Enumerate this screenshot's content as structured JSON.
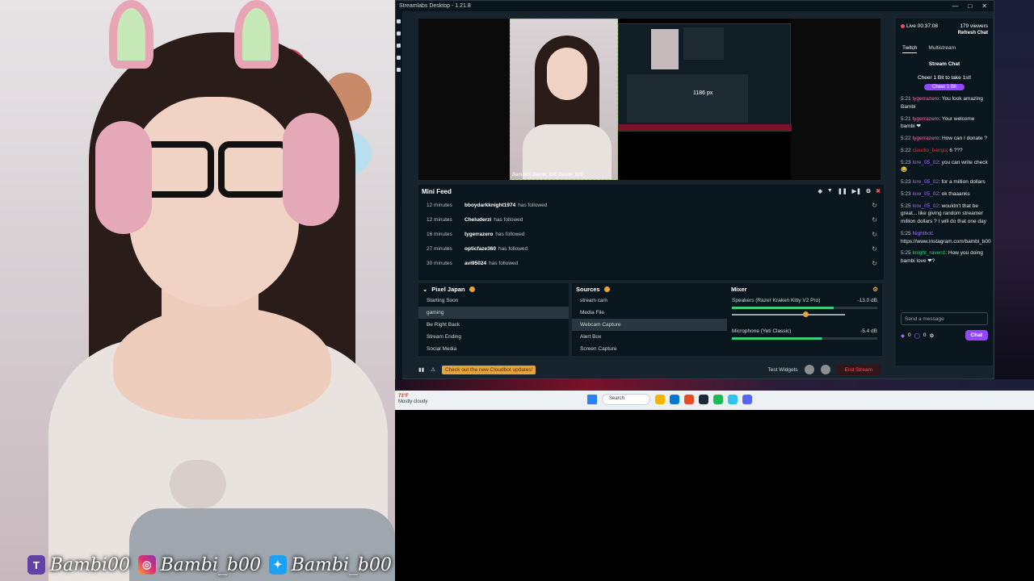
{
  "overlay": {
    "handles": [
      {
        "platform_icon": "twitch-icon",
        "name": "Bambi00"
      },
      {
        "platform_icon": "instagram-icon",
        "name": "Bambi_b00"
      },
      {
        "platform_icon": "twitter-icon",
        "name": "Bambi_b00"
      }
    ]
  },
  "app": {
    "title": "Streamlabs Desktop - 1.21.8",
    "preview_dimension": "1186 px",
    "preview_tag": "Bambi00 Bambi_b00 Bambi_b00"
  },
  "mini_feed": {
    "title": "Mini Feed",
    "events": [
      {
        "ago": "12 minutes",
        "user": "bboydarkknight1974",
        "action": "has followed"
      },
      {
        "ago": "12 minutes",
        "user": "Cheluderzi",
        "action": "has followed"
      },
      {
        "ago": "16 minutes",
        "user": "tygerrazero",
        "action": "has followed"
      },
      {
        "ago": "27 minutes",
        "user": "opticfaze360",
        "action": "has followed"
      },
      {
        "ago": "30 minutes",
        "user": "avi95024",
        "action": "has followed"
      }
    ]
  },
  "scenes": {
    "title": "Pixel Japan",
    "items": [
      "Starting Soon",
      "gaming",
      "Be Right Back",
      "Stream Ending",
      "Social Media"
    ],
    "selected": "gaming"
  },
  "sources": {
    "title": "Sources",
    "items": [
      "stream cam",
      "Media File",
      "Webcam Capture",
      "Alert Box",
      "Screen Capture"
    ],
    "selected": "Webcam Capture"
  },
  "mixer": {
    "title": "Mixer",
    "channels": [
      {
        "name": "Speakers (Razer Kraken Kitty V2 Pro)",
        "db": "-13.0 dB",
        "level": 0.7
      },
      {
        "name": "Microphone (Yeti Classic)",
        "db": "-5.4 dB",
        "level": 0.62
      }
    ]
  },
  "footer": {
    "notice": "Check out the new Cloudbot updates!",
    "test_widgets": "Test Widgets",
    "end_stream": "End Stream"
  },
  "chat": {
    "live_time": "Live 00:37:08",
    "viewers": "179 viewers",
    "refresh": "Refresh Chat",
    "tabs": [
      "Twitch",
      "Multistream"
    ],
    "active_tab": "Twitch",
    "header": "Stream Chat",
    "cheer_prompt": "Cheer 1 Bit to take 1st!",
    "cheer_button": "Cheer 1 Bit",
    "messages": [
      {
        "time": "5:21",
        "user": "tygerrazero",
        "color": "#ff69b4",
        "text": ": You look amazing Bambi"
      },
      {
        "time": "5:21",
        "user": "tygerrazero",
        "color": "#ff69b4",
        "text": ": Your welcome bambi ❤"
      },
      {
        "time": "5:22",
        "user": "tygerrazero",
        "color": "#ff69b4",
        "text": ": How can I donate ?"
      },
      {
        "time": "5:22",
        "user": "claudio_bango",
        "color": "#e0303a",
        "text": ": 6 ???"
      },
      {
        "time": "5:23",
        "user": "lore_05_02",
        "color": "#9d6bff",
        "text": ": you can write check 😂"
      },
      {
        "time": "5:23",
        "user": "lore_05_02",
        "color": "#9d6bff",
        "text": ": for a million dollars"
      },
      {
        "time": "5:23",
        "user": "lore_05_02",
        "color": "#9d6bff",
        "text": ": ok thaaanks"
      },
      {
        "time": "5:25",
        "user": "lore_05_02",
        "color": "#9d6bff",
        "text": ": wouldn't that be great... like giving random streamer million dollars ? I will do that one day"
      },
      {
        "time": "5:25",
        "user": "Nightbot",
        "color": "#9d6bff",
        "text": ": https://www.instagram.com/bambi_b00"
      },
      {
        "time": "5:25",
        "user": "knight_raven1",
        "color": "#3bd07a",
        "text": ": How you doing bambi love ❤?"
      }
    ],
    "input_placeholder": "Send a message",
    "points_a": "0",
    "points_b": "0",
    "send_button": "Chat"
  },
  "taskbar": {
    "weather_temp": "73°F",
    "weather_desc": "Mostly cloudy",
    "search_placeholder": "Search"
  },
  "colors": {
    "accent_orange": "#e8a23b",
    "twitch_purple": "#9147ff",
    "end_stream_red": "#ff4b5c",
    "live_green": "#3bd07a"
  }
}
